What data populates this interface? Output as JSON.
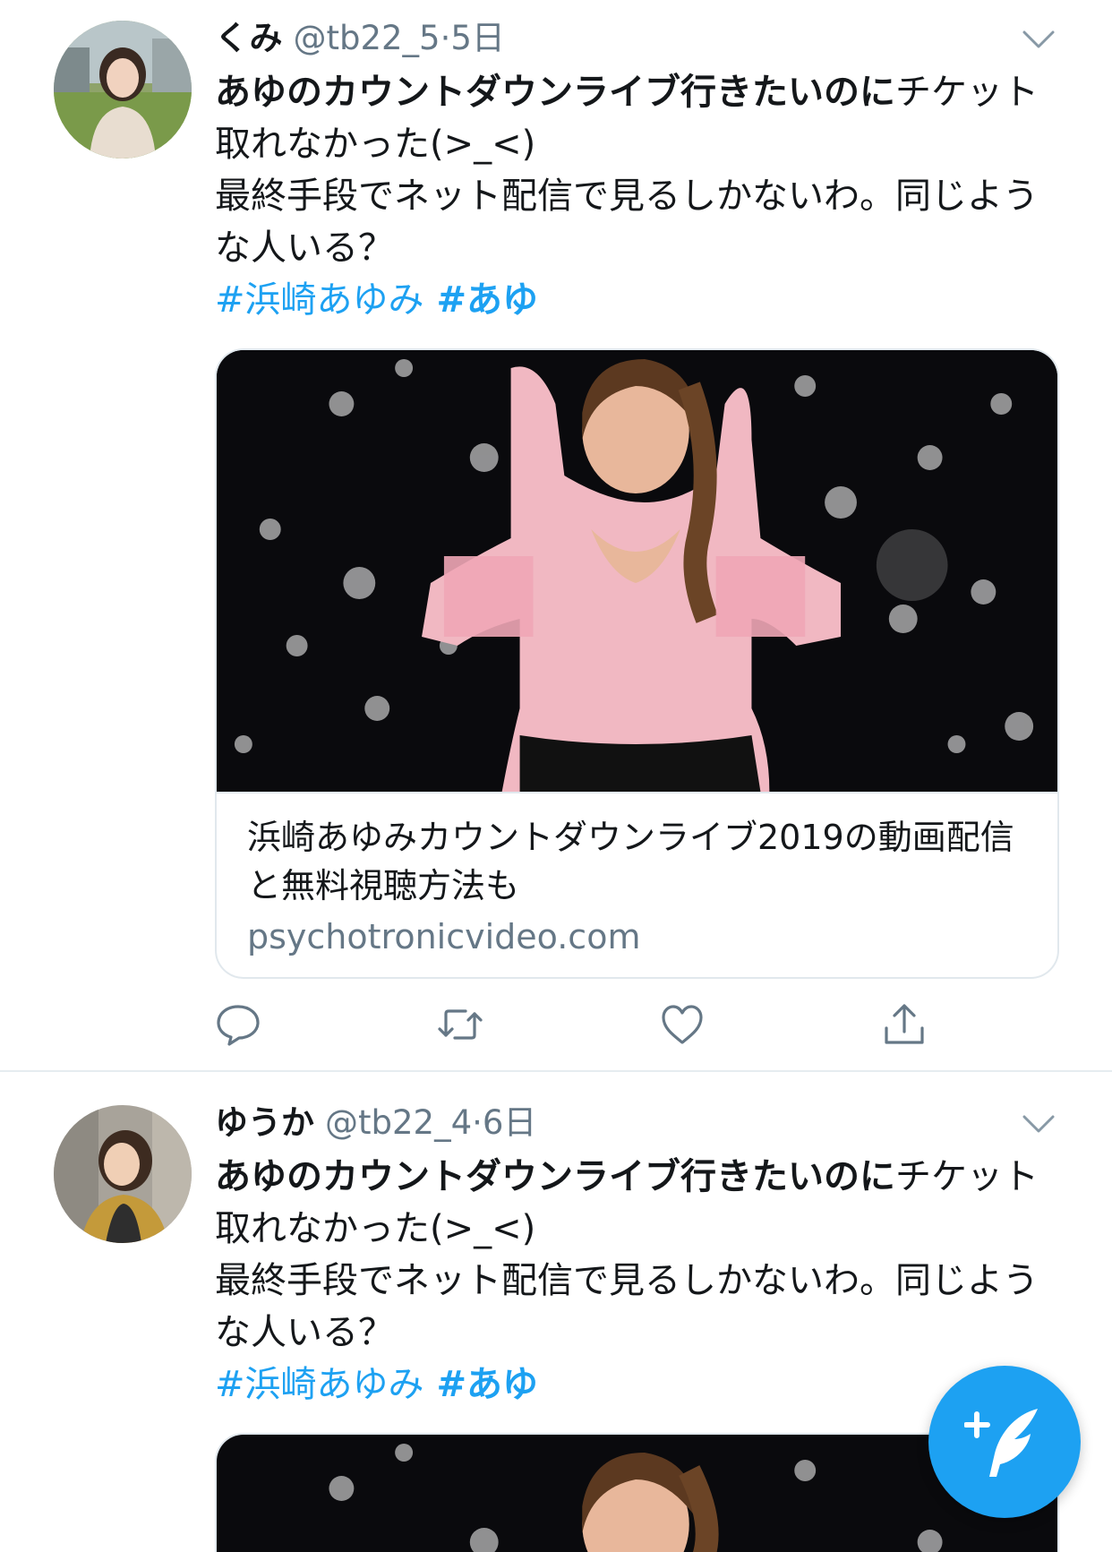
{
  "tweets": [
    {
      "name": "くみ",
      "handle": "@tb22_5",
      "separator": "·",
      "time": "5日",
      "avatar_icon": "avatar-photo",
      "text_bold": "あゆのカウントダウンライブ行きたいのに",
      "text_rest": "チケット取れなかった(>_<)",
      "text_line2": "最終手段でネット配信で見るしかないわ。同じような人いる？",
      "hashtags": [
        "#浜崎あゆみ",
        "#あゆ"
      ],
      "card": {
        "title": "浜崎あゆみカウントダウンライブ2019の動画配信と無料視聴方法も",
        "domain": "psychotronicvideo.com"
      },
      "actions": [
        "reply-icon",
        "retweet-icon",
        "like-icon",
        "share-icon"
      ]
    },
    {
      "name": "ゆうか",
      "handle": "@tb22_4",
      "separator": "·",
      "time": "6日",
      "avatar_icon": "avatar-photo",
      "text_bold": "あゆのカウントダウンライブ行きたいのに",
      "text_rest": "チケット取れなかった(>_<)",
      "text_line2": "最終手段でネット配信で見るしかないわ。同じような人いる？",
      "hashtags": [
        "#浜崎あゆみ",
        "#あゆ"
      ]
    }
  ],
  "compose_button": {
    "icon": "compose-tweet-icon"
  },
  "colors": {
    "accent": "#1da1f2",
    "text_primary": "#14171a",
    "text_secondary": "#657786",
    "border": "#e6ecf0"
  }
}
